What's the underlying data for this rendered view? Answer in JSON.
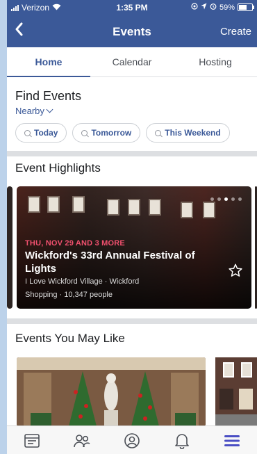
{
  "status_bar": {
    "carrier": "Verizon",
    "time": "1:35 PM",
    "battery": "59%"
  },
  "nav": {
    "back_icon": "chevron-left-icon",
    "title": "Events",
    "create_label": "Create"
  },
  "tabs": [
    {
      "label": "Home",
      "active": true
    },
    {
      "label": "Calendar",
      "active": false
    },
    {
      "label": "Hosting",
      "active": false
    }
  ],
  "find_events": {
    "title": "Find Events",
    "location_label": "Nearby",
    "chips": [
      "Today",
      "Tomorrow",
      "This Weekend"
    ]
  },
  "highlights": {
    "title": "Event Highlights",
    "card": {
      "date": "THU, NOV 29 AND 3 MORE",
      "title": "Wickford's 33rd Annual Festival of Lights",
      "location": "I Love Wickford Village · Wickford",
      "meta": "Shopping · 10,347 people"
    },
    "carousel_dots": 5,
    "active_dot": 2
  },
  "may_like": {
    "title": "Events You May Like"
  },
  "bottom_nav": [
    "feed-icon",
    "friends-icon",
    "profile-icon",
    "notifications-icon",
    "menu-icon"
  ],
  "colors": {
    "brand_blue": "#3b5998",
    "date_red": "#f0506e",
    "active_menu": "#4a4ec4"
  }
}
